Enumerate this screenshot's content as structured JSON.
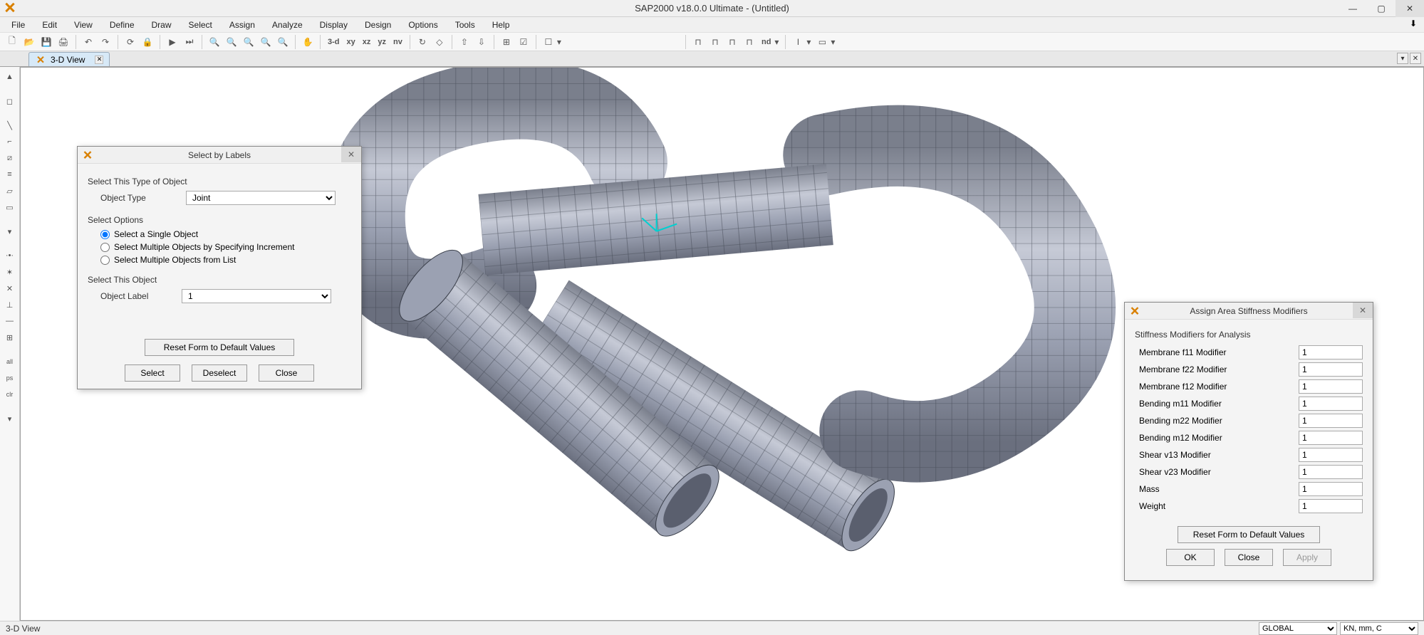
{
  "window": {
    "title": "SAP2000 v18.0.0 Ultimate  - (Untitled)"
  },
  "menu": [
    "File",
    "Edit",
    "View",
    "Define",
    "Draw",
    "Select",
    "Assign",
    "Analyze",
    "Display",
    "Design",
    "Options",
    "Tools",
    "Help"
  ],
  "toolbar_text": {
    "v3d": "3-d",
    "xy": "xy",
    "xz": "xz",
    "yz": "yz",
    "nv": "nv",
    "nd": "nd"
  },
  "tab": {
    "label": "3-D View"
  },
  "status": {
    "left": "3-D View",
    "coord_sys": "GLOBAL",
    "units": "KN, mm, C"
  },
  "dialog_select": {
    "title": "Select by Labels",
    "group1": "Select This Type of Object",
    "object_type_label": "Object Type",
    "object_type_value": "Joint",
    "group2": "Select Options",
    "radio1": "Select a Single Object",
    "radio2": "Select Multiple Objects by Specifying Increment",
    "radio3": "Select Multiple Objects from List",
    "group3": "Select This Object",
    "object_label_label": "Object Label",
    "object_label_value": "1",
    "reset": "Reset Form to Default Values",
    "btn_select": "Select",
    "btn_deselect": "Deselect",
    "btn_close": "Close"
  },
  "dialog_stiff": {
    "title": "Assign Area Stiffness Modifiers",
    "group": "Stiffness Modifiers for Analysis",
    "rows": [
      {
        "label": "Membrane f11 Modifier",
        "value": "1"
      },
      {
        "label": "Membrane f22 Modifier",
        "value": "1"
      },
      {
        "label": "Membrane f12 Modifier",
        "value": "1"
      },
      {
        "label": "Bending m11 Modifier",
        "value": "1"
      },
      {
        "label": "Bending m22 Modifier",
        "value": "1"
      },
      {
        "label": "Bending m12 Modifier",
        "value": "1"
      },
      {
        "label": "Shear v13 Modifier",
        "value": "1"
      },
      {
        "label": "Shear v23 Modifier",
        "value": "1"
      },
      {
        "label": "Mass",
        "value": "1"
      },
      {
        "label": "Weight",
        "value": "1"
      }
    ],
    "reset": "Reset Form to Default Values",
    "btn_ok": "OK",
    "btn_close": "Close",
    "btn_apply": "Apply"
  }
}
